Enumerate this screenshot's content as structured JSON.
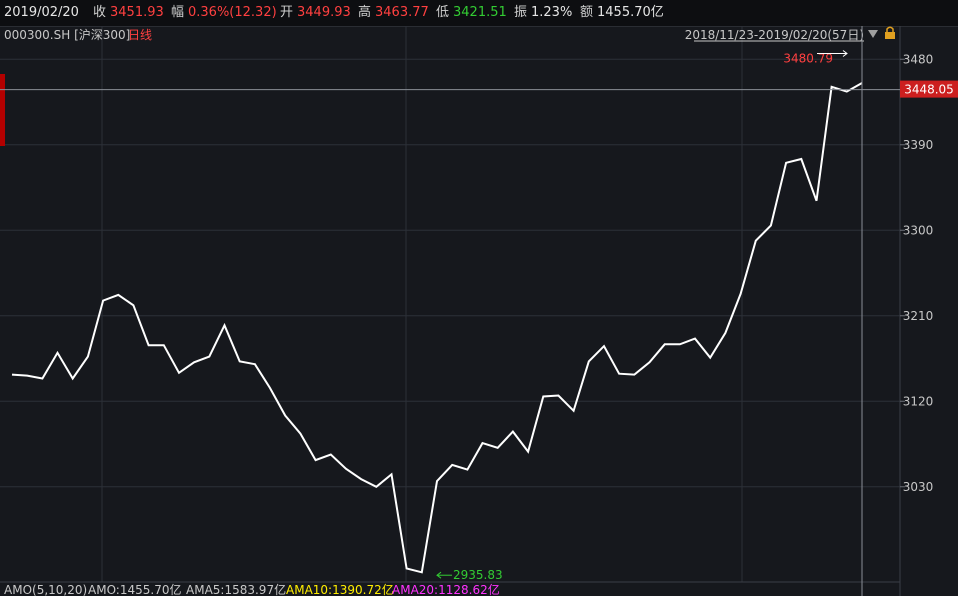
{
  "quote": {
    "date": "2019/02/20",
    "close_label": "收",
    "close": "3451.93",
    "change_label": "幅",
    "change": "0.36%(12.32)",
    "open_label": "开",
    "open": "3449.93",
    "high_label": "高",
    "high": "3463.77",
    "low_label": "低",
    "low": "3421.51",
    "amplitude_label": "振",
    "amplitude": "1.23%",
    "amount_label": "额",
    "amount": "1455.70亿"
  },
  "header": {
    "symbol": "000300.SH [沪深300]",
    "period": "日线",
    "range": "2018/11/23-2019/02/20(57日)"
  },
  "indicators": {
    "name": "AMO(5,10,20)",
    "amo": "AMO:1455.70亿",
    "ama5": "AMA5:1583.97亿",
    "ama10": "AMA10:1390.72亿",
    "ama20": "AMA20:1128.62亿"
  },
  "colors": {
    "line": "#ffffff",
    "up": "#ff4040",
    "down": "#33cc33",
    "ama10": "#ffee00",
    "ama20": "#ff33ff",
    "grid": "#2c3038"
  },
  "chart_data": {
    "type": "line",
    "ylim": [
      2915,
      3515
    ],
    "yticks": [
      3030,
      3120,
      3210,
      3300,
      3390,
      3480
    ],
    "ytick_labels": [
      "3030",
      "3120",
      "3210",
      "3300",
      "3390",
      "3480"
    ],
    "current_value": 3448.05,
    "current_label": "3448.05",
    "max": {
      "value": 3480.79,
      "label": "3480.79"
    },
    "min": {
      "value": 2935.83,
      "label": "2935.83"
    },
    "series": [
      {
        "values": [
          3148,
          3147,
          3144,
          3171,
          3144,
          3167,
          3226,
          3232,
          3221,
          3179,
          3179,
          3150,
          3161,
          3167,
          3200,
          3162,
          3159,
          3134,
          3105,
          3086,
          3058,
          3064,
          3049,
          3038,
          3030,
          3043,
          2944,
          2940,
          3036,
          3053,
          3048,
          3076,
          3071,
          3088,
          3067,
          3125,
          3126,
          3110,
          3162,
          3178,
          3149,
          3148,
          3161,
          3180,
          3180,
          3186,
          3166,
          3192,
          3233,
          3289,
          3305,
          3371,
          3375,
          3331,
          3451,
          3446,
          3455
        ]
      }
    ]
  }
}
